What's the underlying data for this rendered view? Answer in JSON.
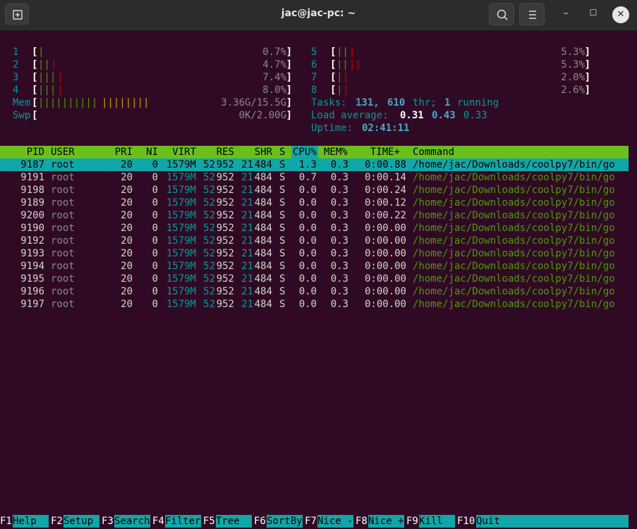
{
  "window": {
    "title": "jac@jac-pc: ~",
    "new_tab_icon": "new-tab-icon",
    "search_icon": "search-icon",
    "menu_icon": "hamburger-menu-icon",
    "minimize_glyph": "–",
    "maximize_glyph": "☐",
    "close_glyph": "✕"
  },
  "cpus_left": [
    {
      "num": "1",
      "bars_g": "|",
      "bars_r": "",
      "pct": "0.7%"
    },
    {
      "num": "2",
      "bars_g": "||",
      "bars_r": "|",
      "pct": "4.7%"
    },
    {
      "num": "3",
      "bars_g": "|||",
      "bars_r": "|",
      "pct": "7.4%"
    },
    {
      "num": "4",
      "bars_g": "|||",
      "bars_r": "|",
      "pct": "8.0%"
    }
  ],
  "cpus_right": [
    {
      "num": "5",
      "bars_g": "||",
      "bars_r": "|",
      "pct": "5.3%"
    },
    {
      "num": "6",
      "bars_g": "||",
      "bars_r": "||",
      "pct": "5.3%"
    },
    {
      "num": "7",
      "bars_g": "|",
      "bars_r": "|",
      "pct": "2.0%"
    },
    {
      "num": "8",
      "bars_g": "|",
      "bars_r": "|",
      "pct": "2.6%"
    }
  ],
  "mem": {
    "label": "Mem",
    "bars_g": "||||||||||",
    "bars_y": "||||||||",
    "value": "3.36G/15.5G"
  },
  "swp": {
    "label": "Swp",
    "value": "0K/2.00G"
  },
  "tasks": {
    "label": "Tasks:",
    "tasks": "131,",
    "threads": "610",
    "thr_label": "thr;",
    "running": "1",
    "running_label": "running"
  },
  "load": {
    "label": "Load average:",
    "one": "0.31",
    "five": "0.43",
    "fifteen": "0.33"
  },
  "uptime": {
    "label": "Uptime:",
    "value": "02:41:11"
  },
  "columns": [
    "PID",
    "USER",
    "PRI",
    "NI",
    "VIRT",
    "RES",
    "SHR",
    "S",
    "CPU%",
    "MEM%",
    "TIME+",
    "Command"
  ],
  "processes": [
    {
      "pid": "9187",
      "user": "root",
      "pri": "20",
      "ni": "0",
      "virt": "1579M",
      "res_a": "52",
      "res_b": "952",
      "shr_a": "21",
      "shr_b": "484",
      "s": "S",
      "cpu": "1.3",
      "mem": "0.3",
      "time": "0:00.88",
      "cmd": "/home/jac/Downloads/coolpy7/bin/go"
    },
    {
      "pid": "9191",
      "user": "root",
      "pri": "20",
      "ni": "0",
      "virt": "1579M",
      "res_a": "52",
      "res_b": "952",
      "shr_a": "21",
      "shr_b": "484",
      "s": "S",
      "cpu": "0.7",
      "mem": "0.3",
      "time": "0:00.14",
      "cmd": "/home/jac/Downloads/coolpy7/bin/go"
    },
    {
      "pid": "9198",
      "user": "root",
      "pri": "20",
      "ni": "0",
      "virt": "1579M",
      "res_a": "52",
      "res_b": "952",
      "shr_a": "21",
      "shr_b": "484",
      "s": "S",
      "cpu": "0.0",
      "mem": "0.3",
      "time": "0:00.24",
      "cmd": "/home/jac/Downloads/coolpy7/bin/go"
    },
    {
      "pid": "9189",
      "user": "root",
      "pri": "20",
      "ni": "0",
      "virt": "1579M",
      "res_a": "52",
      "res_b": "952",
      "shr_a": "21",
      "shr_b": "484",
      "s": "S",
      "cpu": "0.0",
      "mem": "0.3",
      "time": "0:00.12",
      "cmd": "/home/jac/Downloads/coolpy7/bin/go"
    },
    {
      "pid": "9200",
      "user": "root",
      "pri": "20",
      "ni": "0",
      "virt": "1579M",
      "res_a": "52",
      "res_b": "952",
      "shr_a": "21",
      "shr_b": "484",
      "s": "S",
      "cpu": "0.0",
      "mem": "0.3",
      "time": "0:00.22",
      "cmd": "/home/jac/Downloads/coolpy7/bin/go"
    },
    {
      "pid": "9190",
      "user": "root",
      "pri": "20",
      "ni": "0",
      "virt": "1579M",
      "res_a": "52",
      "res_b": "952",
      "shr_a": "21",
      "shr_b": "484",
      "s": "S",
      "cpu": "0.0",
      "mem": "0.3",
      "time": "0:00.00",
      "cmd": "/home/jac/Downloads/coolpy7/bin/go"
    },
    {
      "pid": "9192",
      "user": "root",
      "pri": "20",
      "ni": "0",
      "virt": "1579M",
      "res_a": "52",
      "res_b": "952",
      "shr_a": "21",
      "shr_b": "484",
      "s": "S",
      "cpu": "0.0",
      "mem": "0.3",
      "time": "0:00.00",
      "cmd": "/home/jac/Downloads/coolpy7/bin/go"
    },
    {
      "pid": "9193",
      "user": "root",
      "pri": "20",
      "ni": "0",
      "virt": "1579M",
      "res_a": "52",
      "res_b": "952",
      "shr_a": "21",
      "shr_b": "484",
      "s": "S",
      "cpu": "0.0",
      "mem": "0.3",
      "time": "0:00.00",
      "cmd": "/home/jac/Downloads/coolpy7/bin/go"
    },
    {
      "pid": "9194",
      "user": "root",
      "pri": "20",
      "ni": "0",
      "virt": "1579M",
      "res_a": "52",
      "res_b": "952",
      "shr_a": "21",
      "shr_b": "484",
      "s": "S",
      "cpu": "0.0",
      "mem": "0.3",
      "time": "0:00.00",
      "cmd": "/home/jac/Downloads/coolpy7/bin/go"
    },
    {
      "pid": "9195",
      "user": "root",
      "pri": "20",
      "ni": "0",
      "virt": "1579M",
      "res_a": "52",
      "res_b": "952",
      "shr_a": "21",
      "shr_b": "484",
      "s": "S",
      "cpu": "0.0",
      "mem": "0.3",
      "time": "0:00.00",
      "cmd": "/home/jac/Downloads/coolpy7/bin/go"
    },
    {
      "pid": "9196",
      "user": "root",
      "pri": "20",
      "ni": "0",
      "virt": "1579M",
      "res_a": "52",
      "res_b": "952",
      "shr_a": "21",
      "shr_b": "484",
      "s": "S",
      "cpu": "0.0",
      "mem": "0.3",
      "time": "0:00.00",
      "cmd": "/home/jac/Downloads/coolpy7/bin/go"
    },
    {
      "pid": "9197",
      "user": "root",
      "pri": "20",
      "ni": "0",
      "virt": "1579M",
      "res_a": "52",
      "res_b": "952",
      "shr_a": "21",
      "shr_b": "484",
      "s": "S",
      "cpu": "0.0",
      "mem": "0.3",
      "time": "0:00.00",
      "cmd": "/home/jac/Downloads/coolpy7/bin/go"
    }
  ],
  "fkeys": [
    {
      "key": "F1",
      "label": "Help  "
    },
    {
      "key": "F2",
      "label": "Setup "
    },
    {
      "key": "F3",
      "label": "Search"
    },
    {
      "key": "F4",
      "label": "Filter"
    },
    {
      "key": "F5",
      "label": "Tree  "
    },
    {
      "key": "F6",
      "label": "SortBy"
    },
    {
      "key": "F7",
      "label": "Nice -"
    },
    {
      "key": "F8",
      "label": "Nice +"
    },
    {
      "key": "F9",
      "label": "Kill  "
    },
    {
      "key": "F10",
      "label": "Quit"
    }
  ],
  "colors": {
    "background": "#300A24",
    "header_bar": "#6BBF1C",
    "selected_row": "#11A6A8",
    "green": "#4E9A06",
    "red": "#CC0000",
    "yellow": "#C4A000",
    "cyan": "#06989A"
  }
}
